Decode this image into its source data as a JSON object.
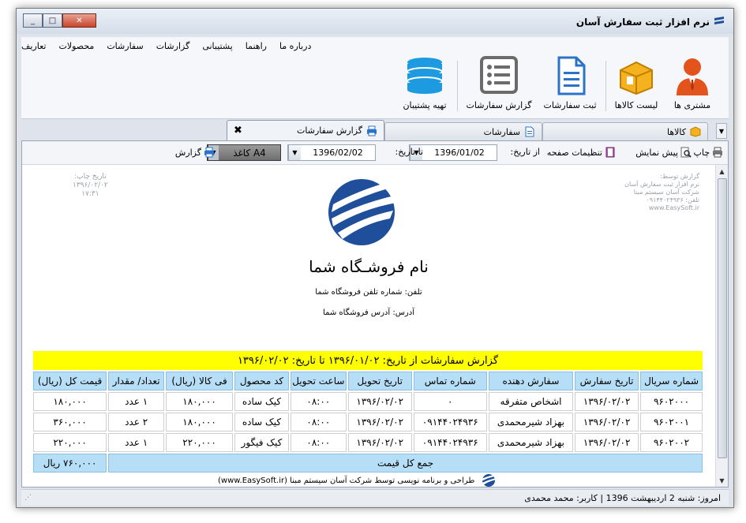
{
  "window": {
    "title": "نرم افزار ثبت سفارش آسان",
    "close": "✕",
    "maximize": "□",
    "minimize": "_"
  },
  "menu": [
    "تعاریف",
    "محصولات",
    "سفارشات",
    "گزارشات",
    "پشتیبانی",
    "راهنما",
    "درباره ما"
  ],
  "ribbon": {
    "customers": "مشتری ها",
    "products_list": "لیست کالاها",
    "new_order": "ثبت سفارشات",
    "orders_report": "گزارش سفارشات",
    "backup": "تهیه پشتیبان"
  },
  "tabs": {
    "products": "کالاها",
    "orders": "سفارشات",
    "orders_report": "گزارش سفارشات",
    "close_glyph": "✖"
  },
  "toolbar": {
    "print": "چاپ",
    "preview": "پیش نمایش",
    "page_setup": "تنظیمات صفحه",
    "from_label": "از تاریخ:",
    "from_value": "1396/01/02",
    "to_label": "تا تاریخ:",
    "to_value": "1396/02/02",
    "paper": "کاغذ A4",
    "report": "گزارش"
  },
  "report": {
    "print_date_label": "تاریخ چاپ:",
    "print_date": "۱۳۹۶/۰۲/۰۲",
    "print_time": "۱۷:۳۱",
    "issuer": [
      "گزارش توسط:",
      "نرم افزار ثبت سفارش آسان",
      "شرکت آسان سیستم مبنا",
      "تلفن: ۰۹۱۴۴۰۲۴۹۳۶",
      "www.EasySoft.ir"
    ],
    "shop_name": "نام فروشـگاه شما",
    "shop_phone": "تلفن: شماره تلفن فروشگاه شما",
    "shop_address": "آدرس: آدرس فروشگاه شما",
    "title": "گزارش سفارشات از تاریخ: ۱۳۹۶/۰۱/۰۲ تا تاریخ: ۱۳۹۶/۰۲/۰۲",
    "columns": [
      "شماره سریال",
      "تاریخ سفارش",
      "سفارش دهنده",
      "شماره تماس",
      "تاریخ تحویل",
      "ساعت تحویل",
      "کد محصول",
      "فی کالا (ریال)",
      "تعداد/ مقدار",
      "قیمت کل (ریال)"
    ],
    "rows": [
      [
        "۹۶۰۲۰۰۰",
        "۱۳۹۶/۰۲/۰۲",
        "اشخاص متفرقه",
        "۰",
        "۱۳۹۶/۰۲/۰۲",
        "۰۸:۰۰",
        "کیک ساده",
        "۱۸۰,۰۰۰",
        "۱ عدد",
        "۱۸۰,۰۰۰"
      ],
      [
        "۹۶۰۲۰۰۱",
        "۱۳۹۶/۰۲/۰۲",
        "بهزاد شیرمحمدی",
        "۰۹۱۴۴۰۲۴۹۳۶",
        "۱۳۹۶/۰۲/۰۲",
        "۰۸:۰۰",
        "کیک ساده",
        "۱۸۰,۰۰۰",
        "۲ عدد",
        "۳۶۰,۰۰۰"
      ],
      [
        "۹۶۰۲۰۰۲",
        "۱۳۹۶/۰۲/۰۲",
        "بهزاد شیرمحمدی",
        "۰۹۱۴۴۰۲۴۹۳۶",
        "۱۳۹۶/۰۲/۰۲",
        "۰۸:۰۰",
        "کیک فیگور",
        "۲۲۰,۰۰۰",
        "۱ عدد",
        "۲۲۰,۰۰۰"
      ]
    ],
    "total_label": "جمع کل قیمت",
    "total_value": "۷۶۰,۰۰۰ ریال",
    "credit": "طراحی و برنامه نویسی توسط شرکت آسان سیستم مبنا (www.EasySoft.ir)"
  },
  "status": {
    "text": "امروز: شنبه 2 اردیبهشت 1396  |  کاربر: محمد محمدی"
  },
  "colors": {
    "title_band": "#ffff00",
    "header": "#b7def7",
    "logo": "#1f4e9b"
  }
}
